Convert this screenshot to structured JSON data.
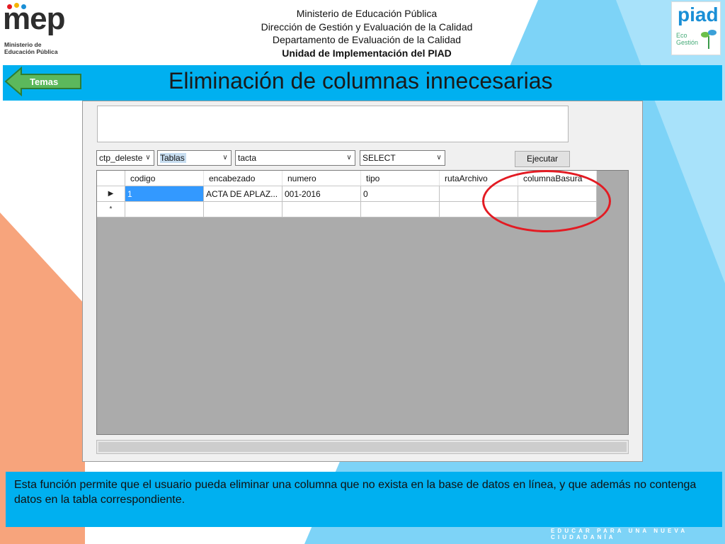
{
  "header": {
    "mep_logo_text": "mep",
    "mep_logo_sub": "Ministerio de Educación Pública",
    "lines": [
      "Ministerio de Educación Pública",
      "Dirección de Gestión y Evaluación de la Calidad",
      "Departamento de Evaluación de la Calidad",
      "Unidad de Implementación del PIAD"
    ],
    "piad_logo_text": "piad",
    "piad_logo_sub": "Eco Gestión"
  },
  "title": {
    "back_label": "Temas",
    "text": "Eliminación de columnas innecesarias"
  },
  "app": {
    "database_combo": "ctp_deleste",
    "type_combo": "Tablas",
    "table_combo": "tacta",
    "action_combo": "SELECT",
    "execute_label": "Ejecutar",
    "grid": {
      "columns": [
        "codigo",
        "encabezado",
        "numero",
        "tipo",
        "rutaArchivo",
        "columnaBasura"
      ],
      "rows": [
        {
          "indicator": "▶",
          "cells": [
            "1",
            "ACTA DE APLAZ...",
            "001-2016",
            "0",
            "",
            ""
          ]
        },
        {
          "indicator": "*",
          "cells": [
            "",
            "",
            "",
            "",
            "",
            ""
          ]
        }
      ]
    }
  },
  "description": "Esta función permite que el usuario pueda eliminar una columna que no exista en la base de datos en línea, y que además no contenga datos en la tabla correspondiente.",
  "footer": "EDUCAR PARA UNA NUEVA CIUDADANÍA",
  "colors": {
    "title_bar": "#00b0f0",
    "background_light_blue": "#7dd3f7",
    "background_orange": "#f7a47c",
    "highlight_ellipse": "#e31b23",
    "temas_arrow": "#4caf50"
  }
}
